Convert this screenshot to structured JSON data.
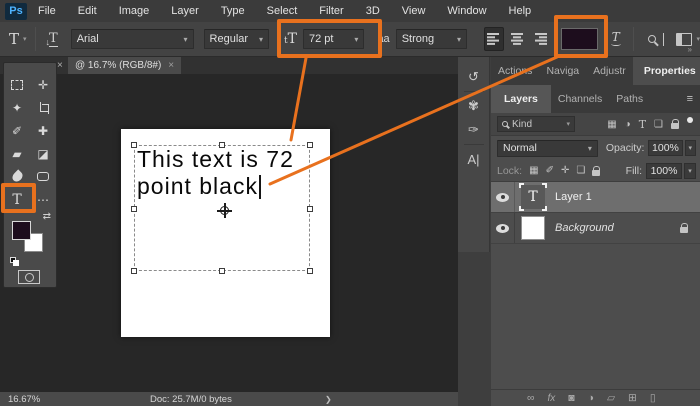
{
  "menu": {
    "logo": "Ps",
    "items": [
      "File",
      "Edit",
      "Image",
      "Layer",
      "Type",
      "Select",
      "Filter",
      "3D",
      "View",
      "Window",
      "Help"
    ]
  },
  "options": {
    "tool_glyph": "T",
    "tool_chevron": "▾",
    "orientation_arrow": "↓",
    "orientation_t": "T",
    "font_family": "Arial",
    "font_style": "Regular",
    "size_icon_small": "t",
    "size_icon_big": "T",
    "font_size": "72 pt",
    "anti_alias_icon": "aa",
    "anti_alias": "Strong",
    "select_chevron": "▾",
    "warp_glyph": "T",
    "overflow_chevron": "»"
  },
  "tabbar": {
    "scroll_glyph": "«",
    "panel_close_glyph": "×",
    "doc_title": "@ 16.7% (RGB/8#)",
    "tab_close_glyph": "×"
  },
  "canvas": {
    "text_line1": "This text is 72",
    "text_line2": "point black"
  },
  "toolbar": {
    "tools": [
      {
        "name": "move",
        "glyph": "✛"
      },
      {
        "name": "magic-wand",
        "glyph": "✦"
      },
      {
        "name": "brush",
        "glyph": "✐"
      },
      {
        "name": "healing-brush",
        "glyph": "✚"
      },
      {
        "name": "eraser",
        "glyph": "▰"
      },
      {
        "name": "paint-bucket",
        "glyph": "◪"
      },
      {
        "name": "type",
        "glyph": "T"
      },
      {
        "name": "more-tools",
        "glyph": "⋯"
      },
      {
        "name": "swap-colors",
        "glyph": "⇄"
      }
    ]
  },
  "status": {
    "zoom": "16.67%",
    "doc_info": "Doc: 25.7M/0 bytes",
    "chevron": "❯"
  },
  "dock_strip": {
    "history_glyph": "↺",
    "brushes_glyph": "✾",
    "brush_settings_glyph": "✑",
    "character_glyph": "A|"
  },
  "panels": {
    "tabs_top": [
      "Actions",
      "Naviga",
      "Adjustr",
      "Properties"
    ],
    "tabs_bottom": [
      "Layers",
      "Channels",
      "Paths"
    ],
    "menu_glyph": "≡",
    "filter": {
      "kind_label": "Kind",
      "pixel_glyph": "▦",
      "adjustment_glyph": "◑",
      "type_glyph": "T",
      "shape_glyph": "❏"
    },
    "blend_mode": "Normal",
    "opacity_label": "Opacity:",
    "opacity_value": "100%",
    "lock_label": "Lock:",
    "lock_transparent_glyph": "▦",
    "lock_paint_glyph": "✐",
    "lock_move_glyph": "✛",
    "lock_artboard_glyph": "❏",
    "fill_label": "Fill:",
    "fill_value": "100%",
    "layers": [
      {
        "name": "Layer 1"
      },
      {
        "name": "Background"
      }
    ],
    "bottom": {
      "link_glyph": "∞",
      "fx_glyph": "fx",
      "mask_glyph": "◙",
      "adjustment_glyph": "◑",
      "group_glyph": "▱",
      "new_layer_glyph": "⊞",
      "delete_glyph": "▯"
    }
  },
  "colors": {
    "accent_orange": "#e8711e",
    "foreground_swatch": "#1d0d1d"
  }
}
